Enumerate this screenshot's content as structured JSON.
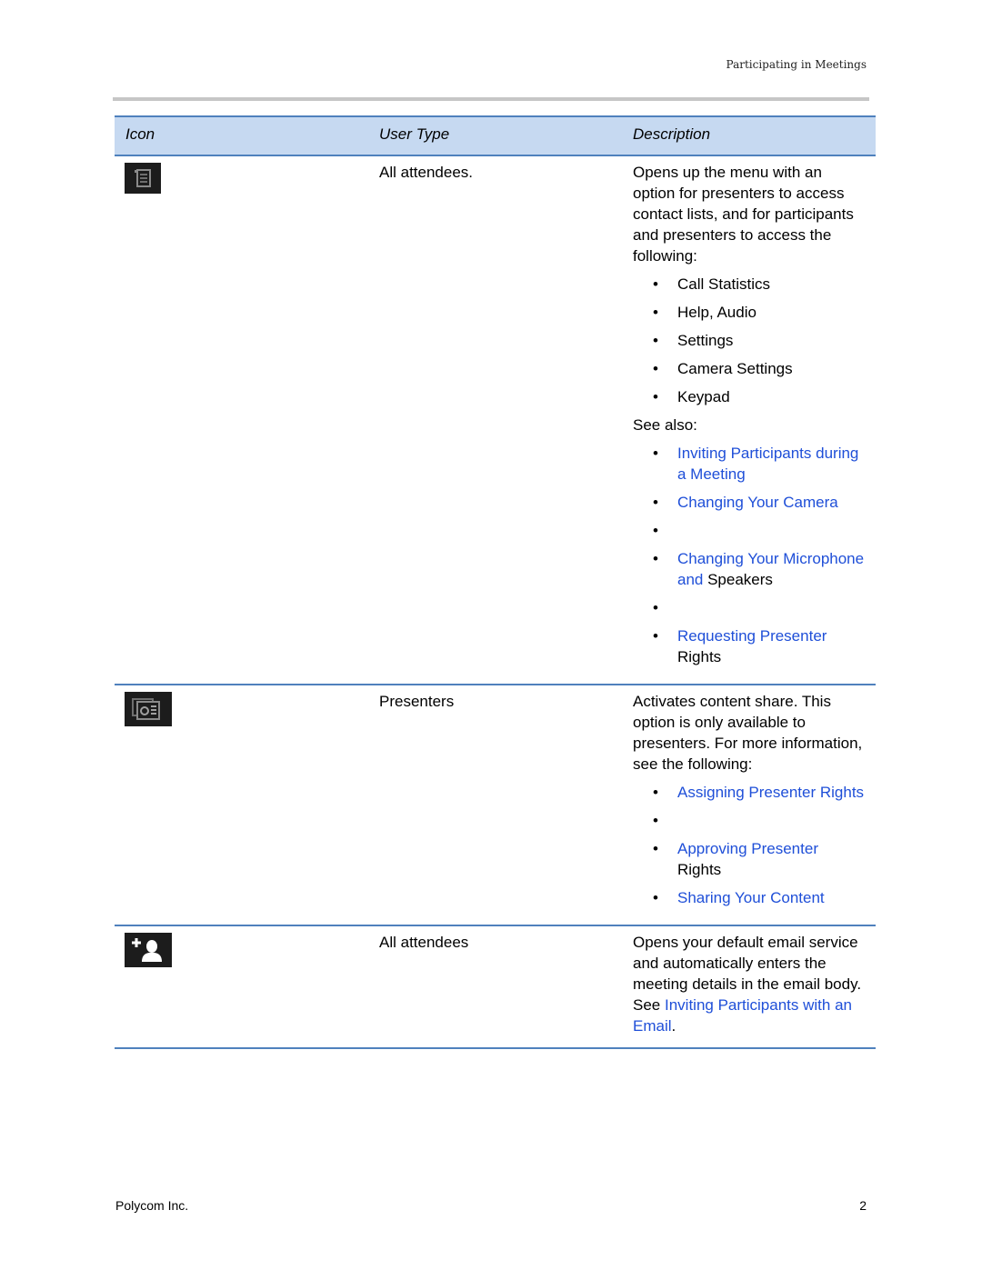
{
  "header": {
    "running_title": "Participating in Meetings"
  },
  "table": {
    "columns": [
      "Icon",
      "User Type",
      "Description"
    ],
    "rows": [
      {
        "icon": "menu-icon",
        "user_type": "All attendees.",
        "description": "Opens up the menu with an option for presenters to access contact lists, and for participants and presenters to access the following:",
        "items": [
          "Call Statistics",
          "Help, Audio",
          "Settings",
          "Camera Settings",
          "Keypad"
        ],
        "see_also_label": "See also:",
        "links": [
          {
            "link": "Inviting Participants during a Meeting",
            "tail": ""
          },
          {
            "link": "Changing Your Camera",
            "tail": ""
          },
          {
            "link": "",
            "tail": ""
          },
          {
            "link": "Changing Your Microphone and",
            "tail": " Speakers"
          },
          {
            "link": "",
            "tail": ""
          },
          {
            "link": "Requesting Presenter",
            "tail": " Rights"
          }
        ]
      },
      {
        "icon": "content-share-icon",
        "user_type": "Presenters",
        "description": "Activates content share. This option is only available to presenters. For more information, see the following:",
        "links": [
          {
            "link": "Assigning Presenter Rights",
            "tail": ""
          },
          {
            "link": "",
            "tail": ""
          },
          {
            "link": "Approving Presenter",
            "tail": " Rights"
          },
          {
            "link": "Sharing Your Content",
            "tail": ""
          }
        ]
      },
      {
        "icon": "add-participant-icon",
        "user_type": "All attendees",
        "description_pre": "Opens your default email service and automatically enters the meeting details in the email body. See ",
        "description_link": "Inviting Participants with an Email",
        "description_post": "."
      }
    ]
  },
  "footer": {
    "company": "Polycom Inc.",
    "page_number": "2"
  },
  "colors": {
    "link": "#1f4fd8",
    "header_fill": "#c6d9f1",
    "rule": "#4f81bd"
  }
}
